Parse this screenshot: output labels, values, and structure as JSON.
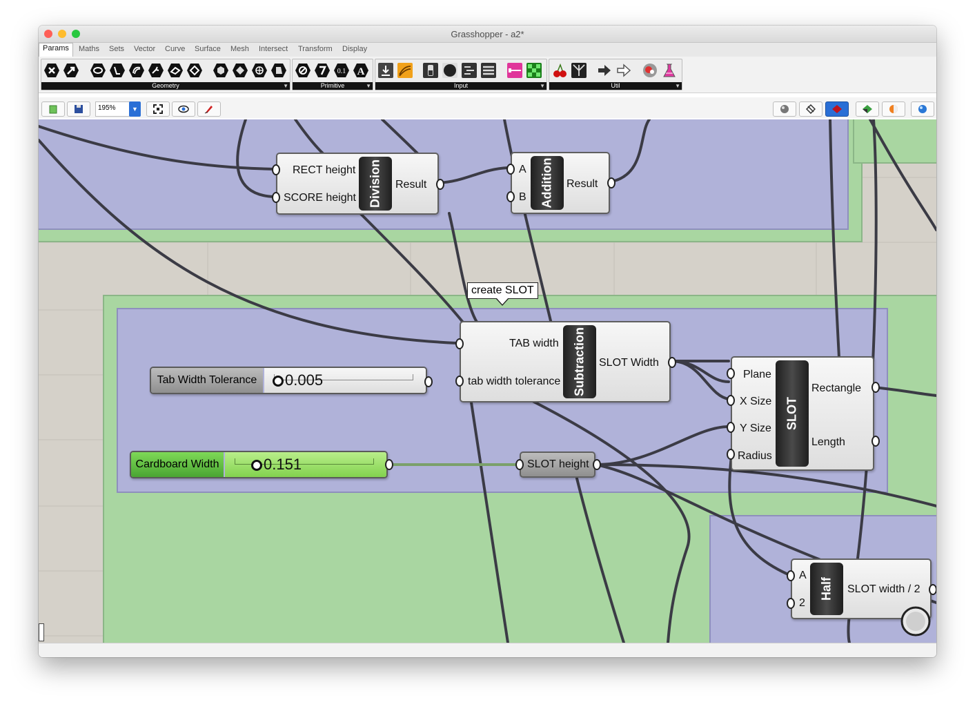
{
  "window": {
    "title": "Grasshopper - a2*"
  },
  "tabs": [
    "Params",
    "Maths",
    "Sets",
    "Vector",
    "Curve",
    "Surface",
    "Mesh",
    "Intersect",
    "Transform",
    "Display"
  ],
  "active_tab": "Params",
  "ribbon": {
    "panels": [
      "Geometry",
      "Primitive",
      "Input",
      "Util"
    ]
  },
  "toolbar": {
    "zoom": "195%"
  },
  "canvas": {
    "tooltip": "create SLOT",
    "components": {
      "division": {
        "name": "Division",
        "inputs": [
          "RECT height",
          "SCORE height"
        ],
        "output": "Result"
      },
      "addition": {
        "name": "Addition",
        "inputs": [
          "A",
          "B"
        ],
        "output": "Result"
      },
      "subtraction": {
        "name": "Subtraction",
        "inputs": [
          "TAB width",
          "tab width tolerance"
        ],
        "output": "SLOT Width"
      },
      "slot": {
        "name": "SLOT",
        "inputs": [
          "Plane",
          "X Size",
          "Y Size",
          "Radius"
        ],
        "outputs": [
          "Rectangle",
          "Length"
        ]
      },
      "half": {
        "name": "Half",
        "inputs": [
          "A",
          "2"
        ],
        "output": "SLOT width / 2"
      }
    },
    "sliders": {
      "tolerance": {
        "name": "Tab Width Tolerance",
        "value": "0.005"
      },
      "cardboard": {
        "name": "Cardboard Width",
        "value": "0.151"
      }
    },
    "param": {
      "slot_height": "SLOT height"
    }
  },
  "colors": {
    "group_green": "#a9d6a1",
    "group_purple": "#b0b2d9",
    "canvas": "#d5d1c9",
    "slider_green": "#7ed957"
  }
}
